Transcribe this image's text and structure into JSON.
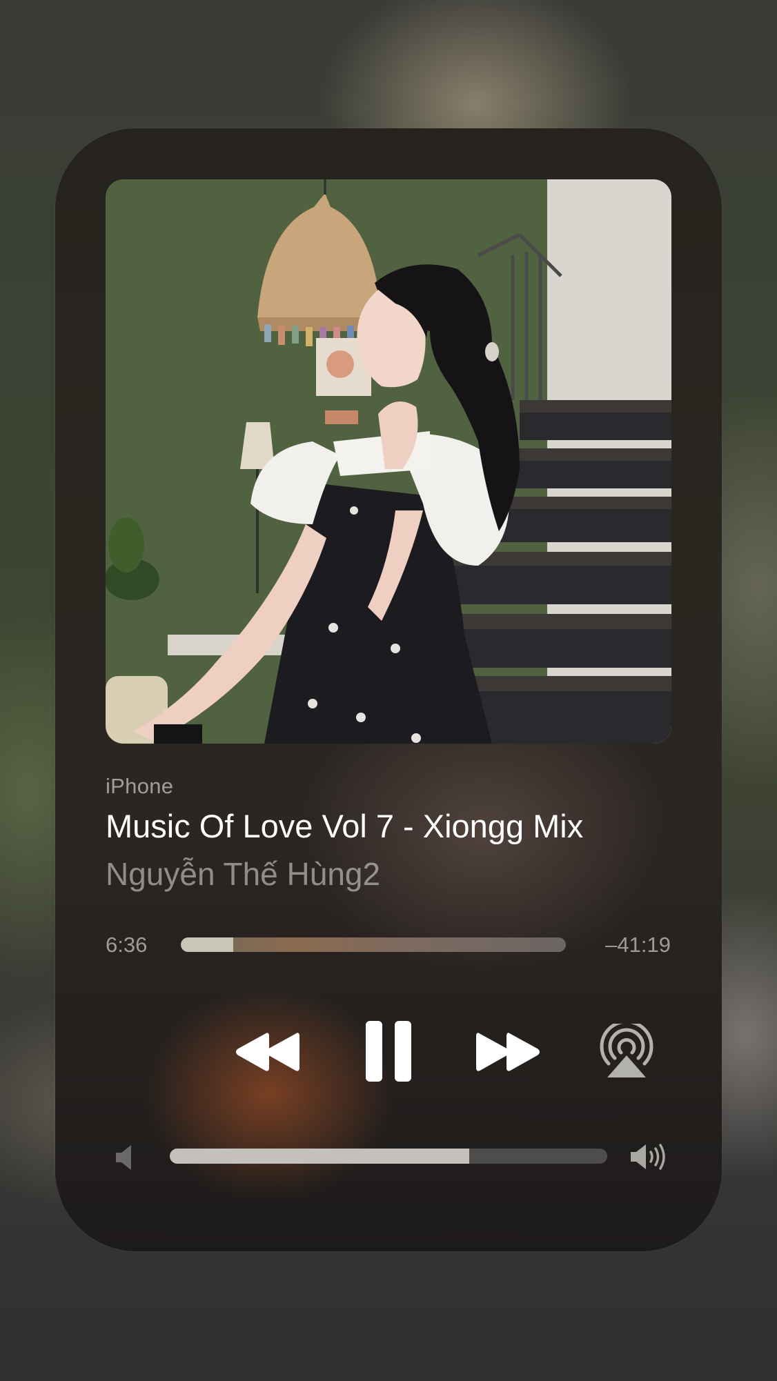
{
  "now_playing": {
    "device": "iPhone",
    "title": "Music Of Love Vol 7 - Xiongg Mix",
    "artist": "Nguyễn Thế Hùng2"
  },
  "playback": {
    "elapsed": "6:36",
    "remaining": "–41:19",
    "progress_fraction": 0.137,
    "state": "playing"
  },
  "controls": {
    "rewind_icon": "rewind-icon",
    "pause_icon": "pause-icon",
    "forward_icon": "fast-forward-icon",
    "airplay_icon": "airplay-icon"
  },
  "volume": {
    "level_fraction": 0.685,
    "low_icon": "speaker-low-icon",
    "high_icon": "speaker-high-icon"
  },
  "colors": {
    "title": "#ffffff",
    "secondary_text": "#8c8a86",
    "progress_fill": "#c9c5b7",
    "volume_fill": "#c4c1bd",
    "volume_track": "#4e4d4c"
  }
}
